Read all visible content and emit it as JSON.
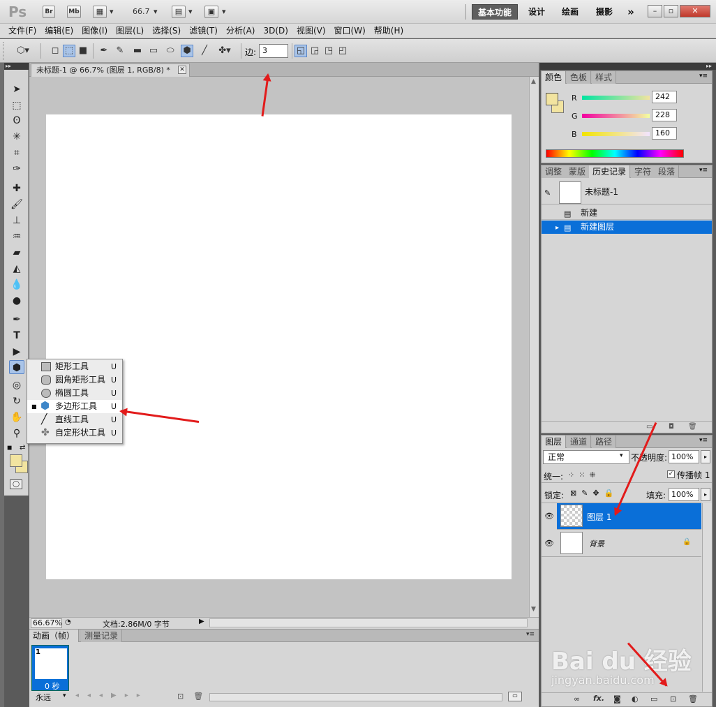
{
  "titlebar": {
    "app_logo": "Ps",
    "bridge_label": "Br",
    "minibridge_label": "Mb",
    "zoom_value": "66.7",
    "workspaces": [
      "基本功能",
      "设计",
      "绘画",
      "摄影"
    ],
    "more_label": "»"
  },
  "menubar": {
    "items": [
      "文件(F)",
      "编辑(E)",
      "图像(I)",
      "图层(L)",
      "选择(S)",
      "滤镜(T)",
      "分析(A)",
      "3D(D)",
      "视图(V)",
      "窗口(W)",
      "帮助(H)"
    ]
  },
  "options": {
    "sides_label": "边:",
    "sides_value": "3"
  },
  "document": {
    "tab_title": "未标题-1 @ 66.7% (图层 1, RGB/8) *",
    "zoom": "66.67%",
    "doc_info": "文档:2.86M/0 字节"
  },
  "flyout": {
    "items": [
      {
        "label": "矩形工具",
        "key": "U",
        "icon": "rectangle-icon"
      },
      {
        "label": "圆角矩形工具",
        "key": "U",
        "icon": "rounded-rectangle-icon"
      },
      {
        "label": "椭圆工具",
        "key": "U",
        "icon": "ellipse-icon"
      },
      {
        "label": "多边形工具",
        "key": "U",
        "icon": "polygon-icon"
      },
      {
        "label": "直线工具",
        "key": "U",
        "icon": "line-icon"
      },
      {
        "label": "自定形状工具",
        "key": "U",
        "icon": "custom-shape-icon"
      }
    ],
    "active_index": 3
  },
  "color_panel": {
    "tabs": [
      "颜色",
      "色板",
      "样式"
    ],
    "r_label": "R",
    "g_label": "G",
    "b_label": "B",
    "r_value": "242",
    "g_value": "228",
    "b_value": "160",
    "fg_color": "#f2e4a0"
  },
  "history_panel": {
    "tabs": [
      "调整",
      "蒙版",
      "历史记录",
      "字符",
      "段落"
    ],
    "snapshot": "未标题-1",
    "states": [
      "新建",
      "新建图层"
    ]
  },
  "layers_panel": {
    "tabs": [
      "图层",
      "通道",
      "路径"
    ],
    "blend_mode": "正常",
    "opacity_label": "不透明度:",
    "opacity_value": "100%",
    "unify_label": "统一:",
    "propagate_label": "传播帧 1",
    "lock_label": "锁定:",
    "fill_label": "填充:",
    "fill_value": "100%",
    "layers": [
      "图层 1",
      "背景"
    ]
  },
  "animation_panel": {
    "tabs": [
      "动画（帧）",
      "测量记录"
    ],
    "frame_number": "1",
    "frame_delay": "0 秒",
    "loop": "永远"
  },
  "watermark": {
    "brand": "Bai du 经验",
    "url": "jingyan.baidu.com"
  },
  "colors": {
    "selection_blue": "#0a6fd8",
    "annotation_red": "#e21b1b"
  }
}
